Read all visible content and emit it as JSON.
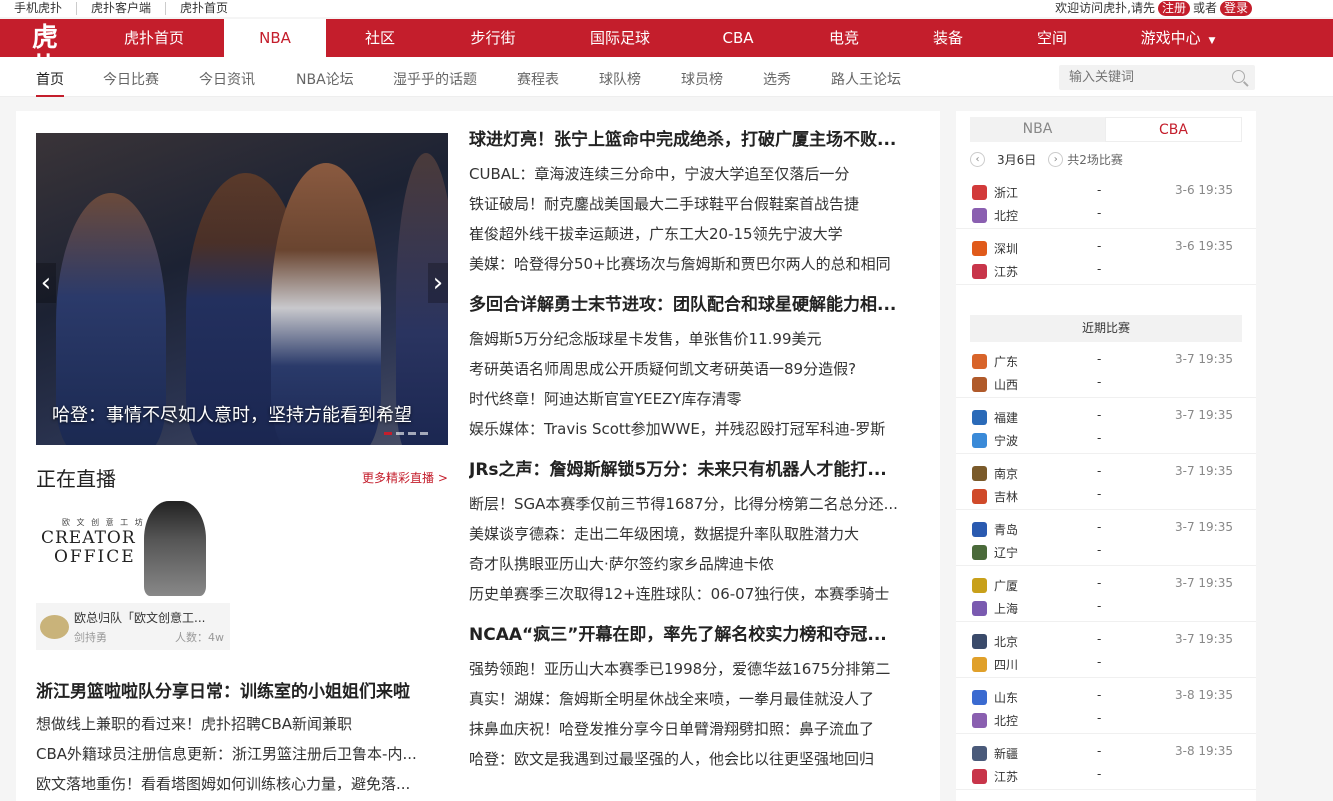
{
  "utilbar": {
    "links": [
      "手机虎扑",
      "虎扑客户端",
      "虎扑首页"
    ],
    "welcome": "欢迎访问虎扑,请先",
    "register": "注册",
    "or": "或者",
    "login": "登录"
  },
  "nav": {
    "logo": "虎扑",
    "items": [
      "虎扑首页",
      "NBA",
      "社区",
      "步行街",
      "国际足球",
      "CBA",
      "电竞",
      "装备",
      "空间",
      "游戏中心"
    ],
    "active": "NBA",
    "dropdown_caret": "caret-down-icon"
  },
  "subnav": {
    "items": [
      "首页",
      "今日比赛",
      "今日资讯",
      "NBA论坛",
      "湿乎乎的话题",
      "赛程表",
      "球队榜",
      "球员榜",
      "选秀",
      "路人王论坛"
    ],
    "search_placeholder": "输入关键词"
  },
  "carousel": {
    "caption": "哈登：事情不尽如人意时，坚持方能看到希望",
    "prev": "‹",
    "next": "›"
  },
  "live": {
    "title": "正在直播",
    "more": "更多精彩直播 >",
    "card": {
      "thumb_small": "欧 文 创 意 工 坊",
      "thumb_line1": "CREATOR",
      "thumb_line2": "OFFICE",
      "title": "欧总归队「欧文创意工...",
      "host": "剑持勇",
      "viewers": "人数：4w"
    }
  },
  "left_news": {
    "headline": "浙江男篮啦啦队分享日常：训练室的小姐姐们来啦",
    "items": [
      "想做线上兼职的看过来！虎扑招聘CBA新闻兼职",
      "CBA外籍球员注册信息更新：浙江男篮注册后卫鲁本-内...",
      "欧文落地重伤！看看塔图姆如何训练核心力量，避免落..."
    ]
  },
  "news_groups": [
    {
      "headline": "球进灯亮！张宁上篮命中完成绝杀，打破广厦主场不败...",
      "items": [
        "CUBAL：章海波连续三分命中，宁波大学追至仅落后一分",
        "铁证破局！耐克鏖战美国最大二手球鞋平台假鞋案首战告捷",
        "崔俊超外线干拔幸运颠进，广东工大20-15领先宁波大学",
        "美媒：哈登得分50+比赛场次与詹姆斯和贾巴尔两人的总和相同"
      ]
    },
    {
      "headline": "多回合详解勇士末节进攻：团队配合和球星硬解能力相...",
      "items": [
        "詹姆斯5万分纪念版球星卡发售，单张售价11.99美元",
        "考研英语名师周思成公开质疑何凯文考研英语一89分造假?",
        "时代终章！阿迪达斯官宣YEEZY库存清零",
        "娱乐媒体：Travis Scott参加WWE，并残忍殴打冠军科迪-罗斯"
      ]
    },
    {
      "headline": "JRs之声：詹姆斯解锁5万分：未来只有机器人才能打...",
      "items": [
        "断层！SGA本赛季仅前三节得1687分，比得分榜第二名总分还...",
        "美媒谈亨德森：走出二年级困境，数据提升率队取胜潜力大",
        "奇才队携眼亚历山大·萨尔签约家乡品牌迪卡侬",
        "历史单赛季三次取得12+连胜球队：06-07独行侠，本赛季骑士"
      ]
    },
    {
      "headline": "NCAA“疯三”开幕在即，率先了解名校实力榜和夺冠...",
      "items": [
        "强势领跑！亚历山大本赛季已1998分，爱德华兹1675分排第二",
        "真实！湖媒：詹姆斯全明星休战全来喷，一拳月最佳就没人了",
        "抹鼻血庆祝！哈登发推分享今日单臂滑翔劈扣照：鼻子流血了",
        "哈登：欧文是我遇到过最坚强的人，他会比以往更坚强地回归"
      ]
    }
  ],
  "side": {
    "tabs": [
      "NBA",
      "CBA"
    ],
    "active_tab": "CBA",
    "date": "3月6日",
    "count": "共2场比赛",
    "today_games": [
      {
        "home": "浙江",
        "away": "北控",
        "home_score": "-",
        "away_score": "-",
        "time": "3-6 19:35",
        "home_color": "#d23a3a",
        "away_color": "#8a5fb0"
      },
      {
        "home": "深圳",
        "away": "江苏",
        "home_score": "-",
        "away_score": "-",
        "time": "3-6 19:35",
        "home_color": "#e05a1a",
        "away_color": "#c8354a"
      }
    ],
    "recent_title": "近期比赛",
    "recent_games": [
      {
        "home": "广东",
        "away": "山西",
        "home_score": "-",
        "away_score": "-",
        "time": "3-7 19:35",
        "home_color": "#d8642a",
        "away_color": "#b05a2a"
      },
      {
        "home": "福建",
        "away": "宁波",
        "home_score": "-",
        "away_score": "-",
        "time": "3-7 19:35",
        "home_color": "#2a6ab8",
        "away_color": "#3a8ad8"
      },
      {
        "home": "南京",
        "away": "吉林",
        "home_score": "-",
        "away_score": "-",
        "time": "3-7 19:35",
        "home_color": "#7a5a2a",
        "away_color": "#d04a2a"
      },
      {
        "home": "青岛",
        "away": "辽宁",
        "home_score": "-",
        "away_score": "-",
        "time": "3-7 19:35",
        "home_color": "#2a5ab0",
        "away_color": "#4a6a3a"
      },
      {
        "home": "广厦",
        "away": "上海",
        "home_score": "-",
        "away_score": "-",
        "time": "3-7 19:35",
        "home_color": "#c8a01a",
        "away_color": "#7a5ab0"
      },
      {
        "home": "北京",
        "away": "四川",
        "home_score": "-",
        "away_score": "-",
        "time": "3-7 19:35",
        "home_color": "#3a4a6a",
        "away_color": "#e0a02a"
      },
      {
        "home": "山东",
        "away": "北控",
        "home_score": "-",
        "away_score": "-",
        "time": "3-8 19:35",
        "home_color": "#3a6ad0",
        "away_color": "#8a5fb0"
      },
      {
        "home": "新疆",
        "away": "江苏",
        "home_score": "-",
        "away_score": "-",
        "time": "3-8 19:35",
        "home_color": "#4a5a7a",
        "away_color": "#c8354a"
      }
    ]
  }
}
